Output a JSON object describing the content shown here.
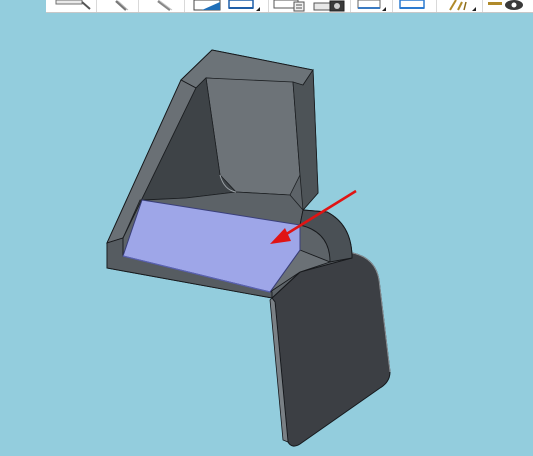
{
  "toolbar": {
    "buttons": [
      {
        "icon": "zoom-to-fit-icon"
      },
      {
        "icon": "zoom-in-icon"
      },
      {
        "icon": "zoom-area-icon"
      },
      {
        "icon": "section-view-icon"
      },
      {
        "icon": "view-orientation-icon"
      },
      {
        "icon": "display-style-icon"
      },
      {
        "icon": "render-camera-icon"
      },
      {
        "icon": "edit-appearance-icon"
      },
      {
        "icon": "apply-scene-icon"
      },
      {
        "icon": "view-settings-icon"
      },
      {
        "icon": "hide-show-items-icon"
      }
    ]
  },
  "viewport": {
    "background_color": "#93cddd",
    "part_body_color": "#5f6569",
    "part_dark_color": "#3a3d41",
    "selected_face_color": "#9ea6e8",
    "annotation_arrow_color": "#e01414"
  }
}
